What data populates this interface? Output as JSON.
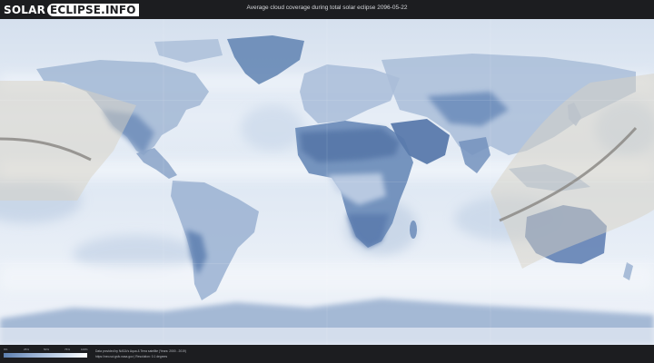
{
  "header": {
    "logo_part1": "SOLAR",
    "logo_part2": "ECLIPSE.INFO",
    "title": "Average cloud coverage during total solar eclipse 2096-05-22"
  },
  "legend": {
    "ticks": [
      "0%",
      "25%",
      "50%",
      "75%",
      "100%"
    ],
    "colors": [
      "#5d80b0",
      "#95add0",
      "#c6d6ea",
      "#ffffff"
    ]
  },
  "footer": {
    "credit_line1": "Data provided by NASA's Aqua & Terra satellite (Years: 2000 - 2019)",
    "credit_line2": "https://neo.sci.gsfc.nasa.gov  |  Resolution: 0.1 degrees"
  },
  "map_colors": {
    "ocean": "#dfe8f3",
    "land_clear": "#6f8db8",
    "path_band": "#d8d2c4",
    "central_line": "#8c8a86"
  }
}
